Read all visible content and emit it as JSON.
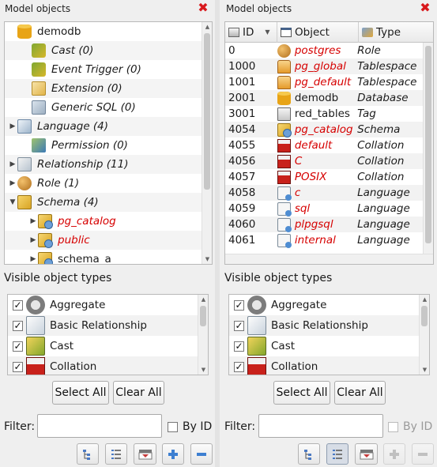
{
  "left": {
    "title": "Model objects",
    "tree": [
      {
        "label": "demodb",
        "icon": "database-icon",
        "italic": false,
        "arrow": ""
      },
      {
        "label": "Cast (0)",
        "icon": "cast-icon",
        "italic": true,
        "arrow": ""
      },
      {
        "label": "Event Trigger (0)",
        "icon": "event-trigger-icon",
        "italic": true,
        "arrow": ""
      },
      {
        "label": "Extension (0)",
        "icon": "extension-icon",
        "italic": true,
        "arrow": ""
      },
      {
        "label": "Generic SQL (0)",
        "icon": "generic-sql-icon",
        "italic": true,
        "arrow": ""
      },
      {
        "label": "Language (4)",
        "icon": "language-icon",
        "italic": true,
        "arrow": "▶"
      },
      {
        "label": "Permission (0)",
        "icon": "permission-icon",
        "italic": true,
        "arrow": ""
      },
      {
        "label": "Relationship (11)",
        "icon": "relationship-icon",
        "italic": true,
        "arrow": "▶"
      },
      {
        "label": "Role (1)",
        "icon": "role-icon",
        "italic": true,
        "arrow": "▶"
      },
      {
        "label": "Schema (4)",
        "icon": "schema-icon",
        "italic": true,
        "arrow": "▼"
      },
      {
        "label": "pg_catalog",
        "icon": "schema-icon",
        "italic": true,
        "red": true,
        "arrow": "▶"
      },
      {
        "label": "public",
        "icon": "schema-icon",
        "italic": true,
        "red": true,
        "arrow": "▶"
      },
      {
        "label": "schema_a",
        "icon": "schema-icon",
        "italic": false,
        "arrow": "▶"
      }
    ],
    "visible_title": "Visible object types",
    "types": [
      {
        "label": "Aggregate",
        "icon": "aggregate-icon",
        "checked": true
      },
      {
        "label": "Basic Relationship",
        "icon": "basic-relationship-icon",
        "checked": true
      },
      {
        "label": "Cast",
        "icon": "cast-icon",
        "checked": true
      },
      {
        "label": "Collation",
        "icon": "collation-icon",
        "checked": true
      }
    ],
    "select_all": "Select All",
    "clear_all": "Clear All",
    "filter_label": "Filter:",
    "filter_value": "",
    "by_id": "By ID"
  },
  "right": {
    "title": "Model objects",
    "columns": {
      "id": "ID",
      "object": "Object",
      "type": "Type"
    },
    "rows": [
      {
        "id": "0",
        "object": "postgres",
        "type": "Role",
        "red": true,
        "icon": "role-icon"
      },
      {
        "id": "1000",
        "object": "pg_global",
        "type": "Tablespace",
        "red": true,
        "icon": "tablespace-icon"
      },
      {
        "id": "1001",
        "object": "pg_default",
        "type": "Tablespace",
        "red": true,
        "icon": "tablespace-icon"
      },
      {
        "id": "2001",
        "object": "demodb",
        "type": "Database",
        "red": false,
        "icon": "database-icon"
      },
      {
        "id": "3001",
        "object": "red_tables",
        "type": "Tag",
        "red": false,
        "icon": "tag-icon"
      },
      {
        "id": "4054",
        "object": "pg_catalog",
        "type": "Schema",
        "red": true,
        "icon": "schema-icon"
      },
      {
        "id": "4055",
        "object": "default",
        "type": "Collation",
        "red": true,
        "icon": "collation-icon"
      },
      {
        "id": "4056",
        "object": "C",
        "type": "Collation",
        "red": true,
        "icon": "collation-icon"
      },
      {
        "id": "4057",
        "object": "POSIX",
        "type": "Collation",
        "red": true,
        "icon": "collation-icon"
      },
      {
        "id": "4058",
        "object": "c",
        "type": "Language",
        "red": true,
        "icon": "language-icon"
      },
      {
        "id": "4059",
        "object": "sql",
        "type": "Language",
        "red": true,
        "icon": "language-icon"
      },
      {
        "id": "4060",
        "object": "plpgsql",
        "type": "Language",
        "red": true,
        "icon": "language-icon"
      },
      {
        "id": "4061",
        "object": "internal",
        "type": "Language",
        "red": true,
        "icon": "language-icon"
      }
    ],
    "visible_title": "Visible object types",
    "types": [
      {
        "label": "Aggregate",
        "icon": "aggregate-icon",
        "checked": true
      },
      {
        "label": "Basic Relationship",
        "icon": "basic-relationship-icon",
        "checked": true
      },
      {
        "label": "Cast",
        "icon": "cast-icon",
        "checked": true
      },
      {
        "label": "Collation",
        "icon": "collation-icon",
        "checked": true
      }
    ],
    "select_all": "Select All",
    "clear_all": "Clear All",
    "filter_label": "Filter:",
    "filter_value": "",
    "by_id": "By ID"
  },
  "colors": {
    "accent_red": "#d60000",
    "close_red": "#d8181c"
  }
}
